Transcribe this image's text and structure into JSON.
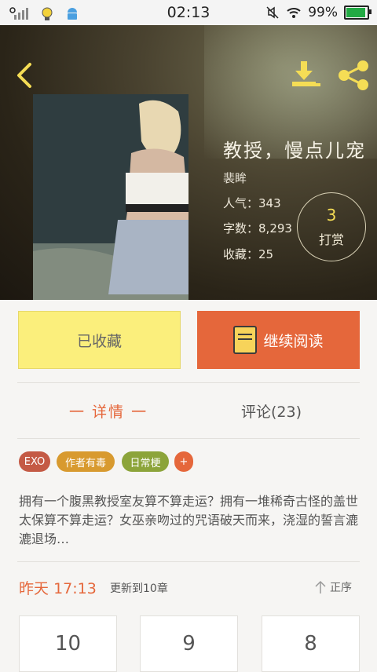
{
  "status_bar": {
    "time": "02:13",
    "battery": "99%",
    "battery_level": 0.99
  },
  "book": {
    "title": "教授，慢点儿宠",
    "author": "裴眸",
    "stats": [
      {
        "label": "人气：",
        "value": "343"
      },
      {
        "label": "字数：",
        "value": "8,293"
      },
      {
        "label": "收藏：",
        "value": "25"
      }
    ],
    "reward": {
      "count": "3",
      "label": "打赏"
    }
  },
  "actions": {
    "favorite_label": "已收藏",
    "read_label": "继续阅读"
  },
  "tabs": {
    "detail": "一 详情 一",
    "comments": "评论(23)"
  },
  "tags": [
    {
      "label": "EXO",
      "color": "#c45a45"
    },
    {
      "label": "作者有毒",
      "color": "#d89a2f"
    },
    {
      "label": "日常梗",
      "color": "#8ca43a"
    },
    {
      "label": "+",
      "color": "#e5673b"
    }
  ],
  "description": "拥有一个腹黑教授室友算不算走运？拥有一堆稀奇古怪的盖世太保算不算走运？女巫亲吻过的咒语破天而来，浇湿的誓言漉漉退场…",
  "update": {
    "day": "昨天",
    "time": "17:13",
    "info": "更新到10章",
    "sort_label": "正序"
  },
  "chapters": [
    "10",
    "9",
    "8"
  ],
  "colors": {
    "accent": "#e5673b",
    "favorite_bg": "#fbef7c",
    "icon_yellow": "#f5dd55"
  }
}
